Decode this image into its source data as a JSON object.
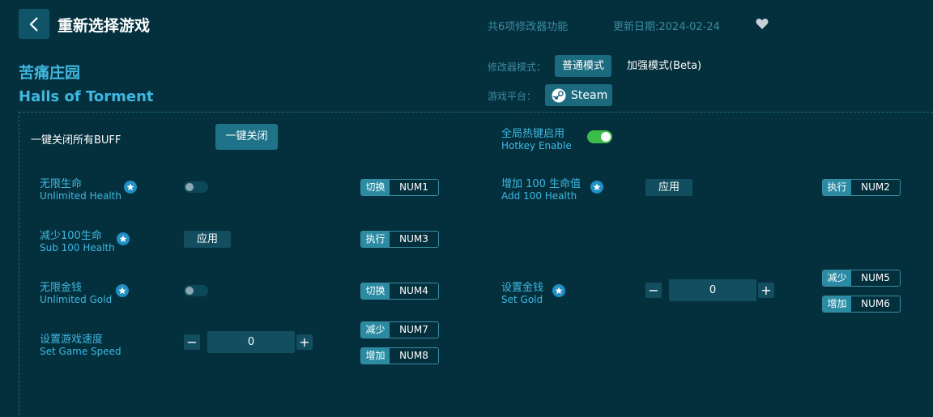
{
  "header": {
    "title": "重新选择游戏",
    "feature_count": "共6项修改器功能",
    "update_date": "更新日期:2024-02-24"
  },
  "game": {
    "name_cn": "苦痛庄园",
    "name_en": "Halls of Torment"
  },
  "mode": {
    "label": "修改器模式：",
    "normal": "普通模式",
    "enhanced": "加强模式(Beta)",
    "selected": "普通模式"
  },
  "platform": {
    "label": "游戏平台：",
    "name": "Steam"
  },
  "top": {
    "disable_all_label": "一键关闭所有BUFF",
    "disable_all_button": "一键关闭",
    "hotkey_cn": "全局热键启用",
    "hotkey_en": "Hotkey Enable",
    "hotkey_enabled": true
  },
  "options": {
    "unlimited_health": {
      "cn": "无限生命",
      "en": "Unlimited Health",
      "enabled": false,
      "action": "切换",
      "key": "NUM1"
    },
    "add_health": {
      "cn": "增加 100 生命值",
      "en": "Add 100 Health",
      "button": "应用",
      "action": "执行",
      "key": "NUM2"
    },
    "sub_health": {
      "cn": "减少100生命",
      "en": "Sub 100 Health",
      "button": "应用",
      "action": "执行",
      "key": "NUM3"
    },
    "unlimited_gold": {
      "cn": "无限金钱",
      "en": "Unlimited Gold",
      "enabled": false,
      "action": "切换",
      "key": "NUM4"
    },
    "set_gold": {
      "cn": "设置金钱",
      "en": "Set Gold",
      "value": "0",
      "minus": "−",
      "plus": "+",
      "dec_action": "减少",
      "dec_key": "NUM5",
      "inc_action": "增加",
      "inc_key": "NUM6"
    },
    "game_speed": {
      "cn": "设置游戏速度",
      "en": "Set Game Speed",
      "value": "0",
      "minus": "−",
      "plus": "+",
      "dec_action": "减少",
      "dec_key": "NUM7",
      "inc_action": "增加",
      "inc_key": "NUM8"
    }
  },
  "icons": {
    "back": "chevron-left-icon",
    "favorite": "heart-icon",
    "steam": "steam-icon",
    "star": "star-icon"
  },
  "colors": {
    "background": "#04303d",
    "accent": "#3fb7e0",
    "toggle_on": "#3bbd4a",
    "button": "#1b6a7e"
  }
}
